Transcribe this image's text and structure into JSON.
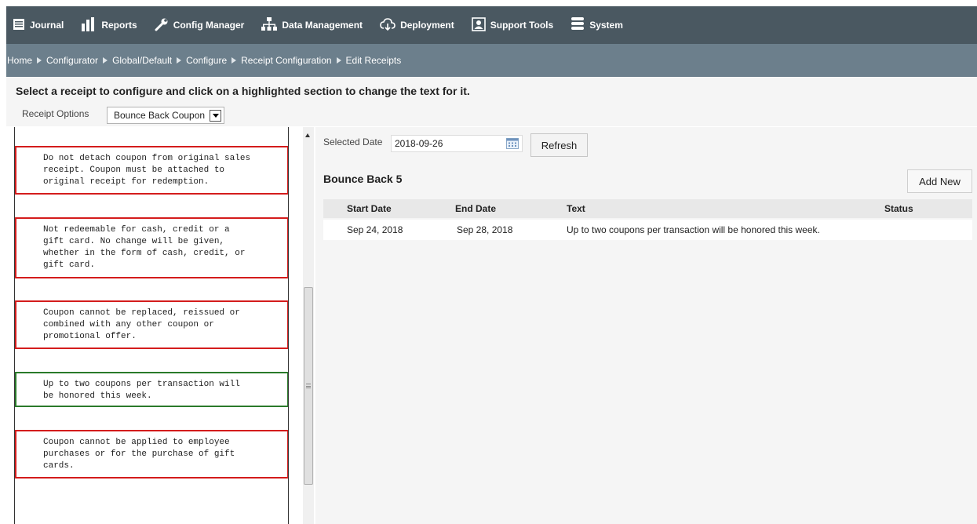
{
  "nav": {
    "items": [
      {
        "label": "Journal",
        "icon": "journal-icon"
      },
      {
        "label": "Reports",
        "icon": "bar-chart-icon"
      },
      {
        "label": "Config Manager",
        "icon": "wrench-icon"
      },
      {
        "label": "Data Management",
        "icon": "hierarchy-icon"
      },
      {
        "label": "Deployment",
        "icon": "cloud-download-icon"
      },
      {
        "label": "Support Tools",
        "icon": "support-person-icon"
      },
      {
        "label": "System",
        "icon": "database-icon"
      }
    ]
  },
  "breadcrumb": [
    "Home",
    "Configurator",
    "Global/Default",
    "Configure",
    "Receipt Configuration",
    "Edit Receipts"
  ],
  "instructions": "Select a receipt to configure and click on a highlighted section to change the text for it.",
  "receipt_options": {
    "label": "Receipt Options",
    "selected": "Bounce Back Coupon"
  },
  "sections": [
    {
      "text": "Do not detach coupon from original sales\nreceipt. Coupon must be attached to\noriginal receipt for redemption.",
      "color": "#d41c1c"
    },
    {
      "text": "Not redeemable for cash, credit or a\ngift card. No change will be given,\nwhether in the form of cash, credit, or\ngift card.",
      "color": "#d41c1c"
    },
    {
      "text": "Coupon cannot be replaced, reissued or\ncombined with any other coupon or\npromotional offer.",
      "color": "#d41c1c"
    },
    {
      "text": "Up to two coupons per transaction will\nbe honored this week.",
      "color": "#2a7a2a"
    },
    {
      "text": "Coupon cannot be applied to employee\npurchases or for the purchase of gift\ncards.",
      "color": "#d41c1c"
    }
  ],
  "date_filter": {
    "label": "Selected Date",
    "value": "2018-09-26",
    "refresh_label": "Refresh"
  },
  "panel": {
    "title": "Bounce Back 5",
    "add_label": "Add New"
  },
  "table": {
    "headers": [
      "Start Date",
      "End Date",
      "Text",
      "Status"
    ],
    "rows": [
      [
        "Sep 24, 2018",
        "Sep 28, 2018",
        "Up to two coupons per transaction will be honored this week.",
        ""
      ]
    ]
  },
  "colors": {
    "nav_bg": "#4a5861",
    "crumb_bg": "#6c7f8c",
    "section_border": "#d41c1c",
    "active_section_border": "#2a7a2a"
  }
}
